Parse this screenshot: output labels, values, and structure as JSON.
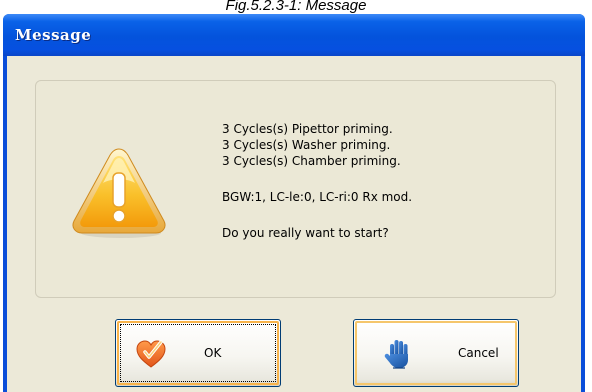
{
  "figure_caption": "Fig.5.2.3-1: Message",
  "window": {
    "title": "Message"
  },
  "message": {
    "lines": [
      "3 Cycles(s) Pipettor priming.",
      "3 Cycles(s) Washer priming.",
      "3 Cycles(s) Chamber priming.",
      "BGW:1, LC-le:0, LC-ri:0 Rx mod.",
      "Do you really want to start?"
    ],
    "icon": "warning-icon"
  },
  "buttons": {
    "ok_label": "OK",
    "ok_icon": "check-heart-icon",
    "cancel_label": "Cancel",
    "cancel_icon": "stop-hand-icon"
  },
  "colors": {
    "titlebar": "#0453dc",
    "client_background": "#ece9d8",
    "warning_yellow": "#f7b21a",
    "ok_icon_orange": "#f06a1a",
    "cancel_icon_blue": "#1d5fb0"
  }
}
